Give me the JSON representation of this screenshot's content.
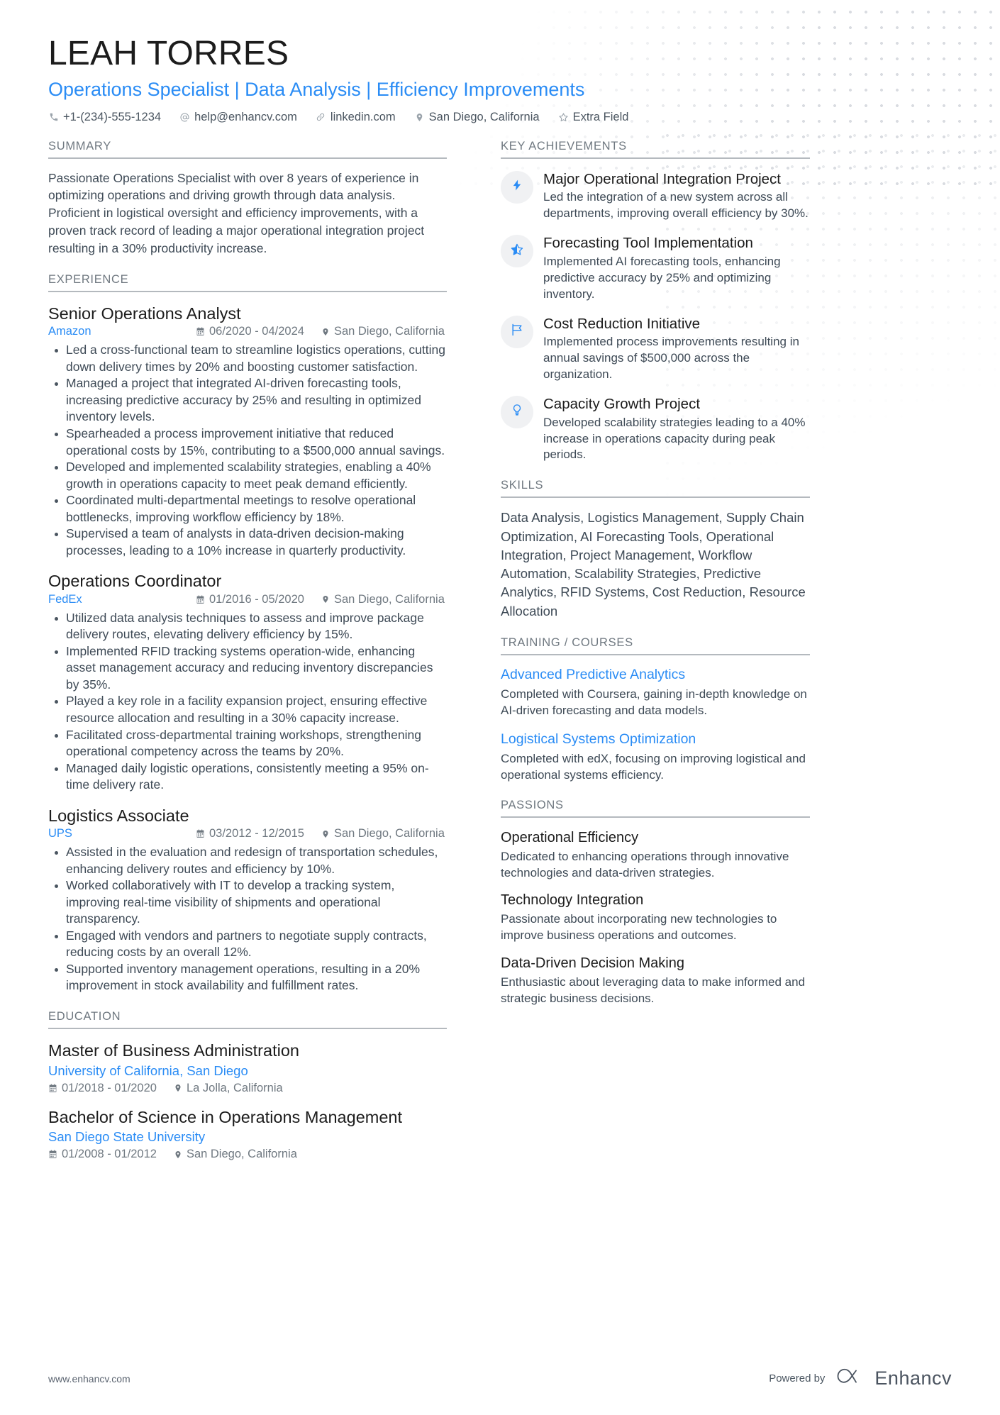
{
  "header": {
    "name": "LEAH TORRES",
    "headline": "Operations Specialist | Data Analysis | Efficiency Improvements",
    "accent_color": "#2a8cf5",
    "contacts": [
      {
        "icon": "phone-icon",
        "text": "+1-(234)-555-1234"
      },
      {
        "icon": "at-sign-icon",
        "text": "help@enhancv.com"
      },
      {
        "icon": "link-icon",
        "text": "linkedin.com"
      },
      {
        "icon": "location-pin-icon",
        "text": "San Diego, California"
      },
      {
        "icon": "star-outline-icon",
        "text": "Extra Field"
      }
    ]
  },
  "summary": {
    "title": "SUMMARY",
    "text": "Passionate Operations Specialist with over 8 years of experience in optimizing operations and driving growth through data analysis. Proficient in logistical oversight and efficiency improvements, with a proven track record of leading a major operational integration project resulting in a 30% productivity increase."
  },
  "experience": {
    "title": "EXPERIENCE",
    "entries": [
      {
        "role": "Senior Operations Analyst",
        "company": "Amazon",
        "dates": "06/2020 - 04/2024",
        "location": "San Diego, California",
        "bullets": [
          "Led a cross-functional team to streamline logistics operations, cutting down delivery times by 20% and boosting customer satisfaction.",
          "Managed a project that integrated AI-driven forecasting tools, increasing predictive accuracy by 25% and resulting in optimized inventory levels.",
          "Spearheaded a process improvement initiative that reduced operational costs by 15%, contributing to a $500,000 annual savings.",
          "Developed and implemented scalability strategies, enabling a 40% growth in operations capacity to meet peak demand efficiently.",
          "Coordinated multi-departmental meetings to resolve operational bottlenecks, improving workflow efficiency by 18%.",
          "Supervised a team of analysts in data-driven decision-making processes, leading to a 10% increase in quarterly productivity."
        ]
      },
      {
        "role": "Operations Coordinator",
        "company": "FedEx",
        "dates": "01/2016 - 05/2020",
        "location": "San Diego, California",
        "bullets": [
          "Utilized data analysis techniques to assess and improve package delivery routes, elevating delivery efficiency by 15%.",
          "Implemented RFID tracking systems operation-wide, enhancing asset management accuracy and reducing inventory discrepancies by 35%.",
          "Played a key role in a facility expansion project, ensuring effective resource allocation and resulting in a 30% capacity increase.",
          "Facilitated cross-departmental training workshops, strengthening operational competency across the teams by 20%.",
          "Managed daily logistic operations, consistently meeting a 95% on-time delivery rate."
        ]
      },
      {
        "role": "Logistics Associate",
        "company": "UPS",
        "dates": "03/2012 - 12/2015",
        "location": "San Diego, California",
        "bullets": [
          "Assisted in the evaluation and redesign of transportation schedules, enhancing delivery routes and efficiency by 10%.",
          "Worked collaboratively with IT to develop a tracking system, improving real-time visibility of shipments and operational transparency.",
          "Engaged with vendors and partners to negotiate supply contracts, reducing costs by an overall 12%.",
          "Supported inventory management operations, resulting in a 20% improvement in stock availability and fulfillment rates."
        ]
      }
    ]
  },
  "education": {
    "title": "EDUCATION",
    "entries": [
      {
        "degree": "Master of Business Administration",
        "school": "University of California, San Diego",
        "dates": "01/2018 - 01/2020",
        "location": "La Jolla, California"
      },
      {
        "degree": "Bachelor of Science in Operations Management",
        "school": "San Diego State University",
        "dates": "01/2008 - 01/2012",
        "location": "San Diego, California"
      }
    ]
  },
  "achievements": {
    "title": "KEY ACHIEVEMENTS",
    "items": [
      {
        "icon": "lightning-bolt-icon",
        "title": "Major Operational Integration Project",
        "desc": "Led the integration of a new system across all departments, improving overall efficiency by 30%."
      },
      {
        "icon": "star-icon",
        "title": "Forecasting Tool Implementation",
        "desc": "Implemented AI forecasting tools, enhancing predictive accuracy by 25% and optimizing inventory."
      },
      {
        "icon": "flag-icon",
        "title": "Cost Reduction Initiative",
        "desc": "Implemented process improvements resulting in annual savings of $500,000 across the organization."
      },
      {
        "icon": "lightbulb-icon",
        "title": "Capacity Growth Project",
        "desc": "Developed scalability strategies leading to a 40% increase in operations capacity during peak periods."
      }
    ]
  },
  "skills": {
    "title": "SKILLS",
    "text": "Data Analysis, Logistics Management, Supply Chain Optimization, AI Forecasting Tools, Operational Integration, Project Management, Workflow Automation, Scalability Strategies, Predictive Analytics, RFID Systems, Cost Reduction, Resource Allocation"
  },
  "training": {
    "title": "TRAINING / COURSES",
    "items": [
      {
        "title": "Advanced Predictive Analytics",
        "desc": "Completed with Coursera, gaining in-depth knowledge on AI-driven forecasting and data models."
      },
      {
        "title": "Logistical Systems Optimization",
        "desc": "Completed with edX, focusing on improving logistical and operational systems efficiency."
      }
    ]
  },
  "passions": {
    "title": "PASSIONS",
    "items": [
      {
        "title": "Operational Efficiency",
        "desc": "Dedicated to enhancing operations through innovative technologies and data-driven strategies."
      },
      {
        "title": "Technology Integration",
        "desc": "Passionate about incorporating new technologies to improve business operations and outcomes."
      },
      {
        "title": "Data-Driven Decision Making",
        "desc": "Enthusiastic about leveraging data to make informed and strategic business decisions."
      }
    ]
  },
  "footer": {
    "url": "www.enhancv.com",
    "powered_label": "Powered by",
    "brand": "Enhancv"
  }
}
